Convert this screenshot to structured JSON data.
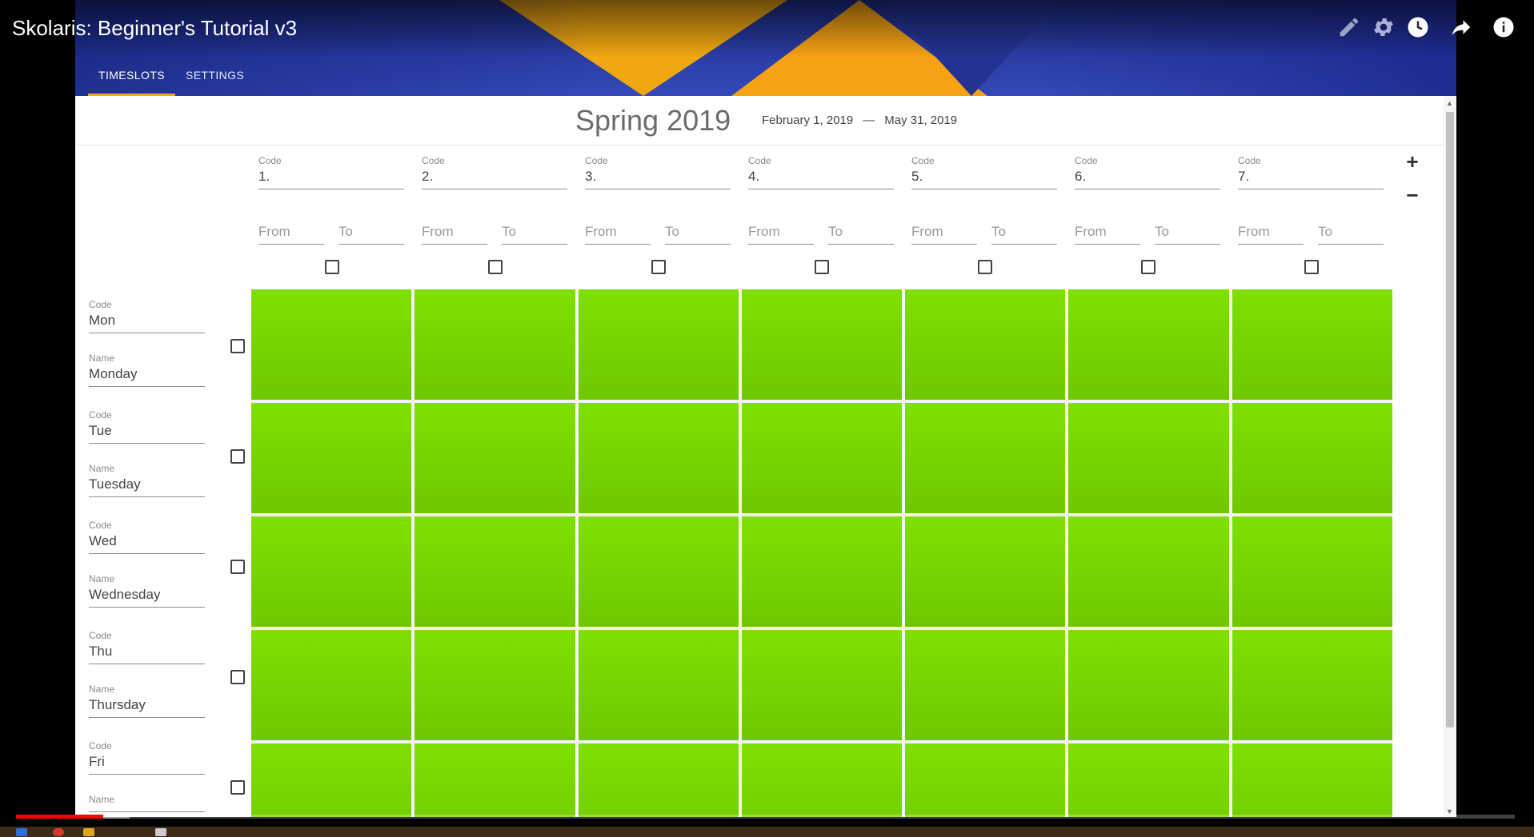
{
  "video": {
    "title": "Skolaris: Beginner's Tutorial v3",
    "progress_fraction": 0.058,
    "buffered_fraction": 0.076,
    "icons": [
      "pencil-icon",
      "gear-icon",
      "clock-icon",
      "share-icon",
      "info-icon"
    ]
  },
  "app": {
    "tabs": [
      {
        "label": "TIMESLOTS",
        "active": true
      },
      {
        "label": "SETTINGS",
        "active": false
      }
    ],
    "term": {
      "name": "Spring 2019",
      "start": "February 1, 2019",
      "separator": "—",
      "end": "May 31, 2019"
    },
    "timeslots": [
      {
        "code_label": "Code",
        "code": "1.",
        "from_placeholder": "From",
        "to_placeholder": "To"
      },
      {
        "code_label": "Code",
        "code": "2.",
        "from_placeholder": "From",
        "to_placeholder": "To"
      },
      {
        "code_label": "Code",
        "code": "3.",
        "from_placeholder": "From",
        "to_placeholder": "To"
      },
      {
        "code_label": "Code",
        "code": "4.",
        "from_placeholder": "From",
        "to_placeholder": "To"
      },
      {
        "code_label": "Code",
        "code": "5.",
        "from_placeholder": "From",
        "to_placeholder": "To"
      },
      {
        "code_label": "Code",
        "code": "6.",
        "from_placeholder": "From",
        "to_placeholder": "To"
      },
      {
        "code_label": "Code",
        "code": "7.",
        "from_placeholder": "From",
        "to_placeholder": "To"
      }
    ],
    "add_label": "+",
    "remove_label": "−",
    "days": [
      {
        "code_label": "Code",
        "code": "Mon",
        "name_label": "Name",
        "name": "Monday"
      },
      {
        "code_label": "Code",
        "code": "Tue",
        "name_label": "Name",
        "name": "Tuesday"
      },
      {
        "code_label": "Code",
        "code": "Wed",
        "name_label": "Name",
        "name": "Wednesday"
      },
      {
        "code_label": "Code",
        "code": "Thu",
        "name_label": "Name",
        "name": "Thursday"
      },
      {
        "code_label": "Code",
        "code": "Fri",
        "name_label": "Name",
        "name": ""
      }
    ],
    "colors": {
      "available_cell": "#7fe000",
      "header_blue": "#2a3ca5",
      "header_orange": "#f5a623",
      "tab_indicator": "#f5a623"
    }
  }
}
